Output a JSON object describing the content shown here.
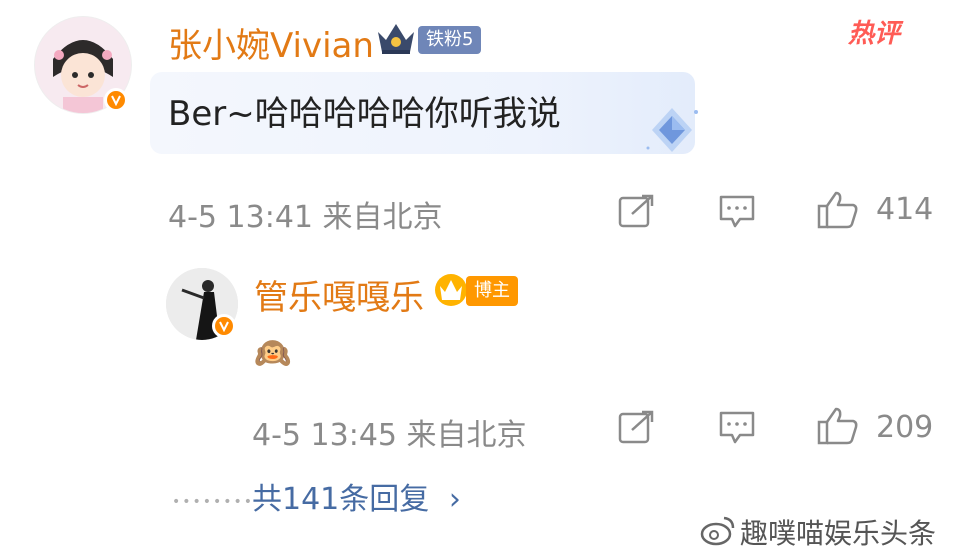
{
  "comment": {
    "username": "张小婉Vivian",
    "fan_badge": "铁粉5",
    "hot_tag": "热评",
    "text": "Ber~哈哈哈哈哈你听我说",
    "meta": "4-5 13:41  来自北京",
    "likes": "414"
  },
  "reply": {
    "username": "管乐嘎嘎乐",
    "role_badge": "博主",
    "text": "🙉",
    "meta": "4-5 13:45  来自北京",
    "likes": "209"
  },
  "more_replies": {
    "label": "共141条回复",
    "chevron": "›"
  },
  "watermark": "趣噗喵娱乐头条",
  "colors": {
    "username": "#e27a15",
    "link": "#466ba3",
    "meta": "#8a8a8a",
    "hot": "#ff5b55",
    "fan_badge": "#6f86b8",
    "blogger_badge": "#ff9800"
  },
  "icons": [
    "v-verified-icon",
    "crown-icon",
    "share-icon",
    "comment-icon",
    "like-icon",
    "diamond-sticker-icon",
    "weibo-logo-icon"
  ]
}
